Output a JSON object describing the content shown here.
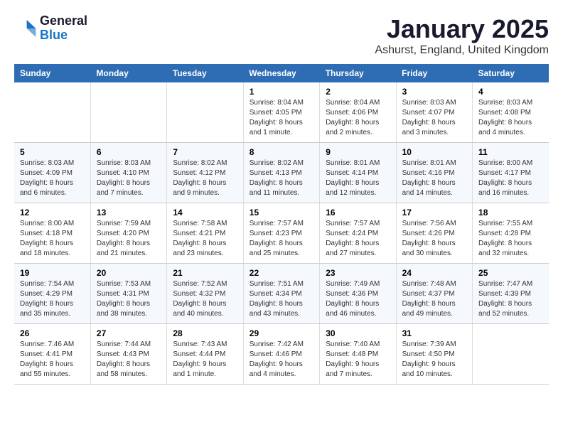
{
  "logo": {
    "line1": "General",
    "line2": "Blue"
  },
  "title": "January 2025",
  "subtitle": "Ashurst, England, United Kingdom",
  "weekdays": [
    "Sunday",
    "Monday",
    "Tuesday",
    "Wednesday",
    "Thursday",
    "Friday",
    "Saturday"
  ],
  "weeks": [
    [
      {
        "day": "",
        "info": ""
      },
      {
        "day": "",
        "info": ""
      },
      {
        "day": "",
        "info": ""
      },
      {
        "day": "1",
        "info": "Sunrise: 8:04 AM\nSunset: 4:05 PM\nDaylight: 8 hours and 1 minute."
      },
      {
        "day": "2",
        "info": "Sunrise: 8:04 AM\nSunset: 4:06 PM\nDaylight: 8 hours and 2 minutes."
      },
      {
        "day": "3",
        "info": "Sunrise: 8:03 AM\nSunset: 4:07 PM\nDaylight: 8 hours and 3 minutes."
      },
      {
        "day": "4",
        "info": "Sunrise: 8:03 AM\nSunset: 4:08 PM\nDaylight: 8 hours and 4 minutes."
      }
    ],
    [
      {
        "day": "5",
        "info": "Sunrise: 8:03 AM\nSunset: 4:09 PM\nDaylight: 8 hours and 6 minutes."
      },
      {
        "day": "6",
        "info": "Sunrise: 8:03 AM\nSunset: 4:10 PM\nDaylight: 8 hours and 7 minutes."
      },
      {
        "day": "7",
        "info": "Sunrise: 8:02 AM\nSunset: 4:12 PM\nDaylight: 8 hours and 9 minutes."
      },
      {
        "day": "8",
        "info": "Sunrise: 8:02 AM\nSunset: 4:13 PM\nDaylight: 8 hours and 11 minutes."
      },
      {
        "day": "9",
        "info": "Sunrise: 8:01 AM\nSunset: 4:14 PM\nDaylight: 8 hours and 12 minutes."
      },
      {
        "day": "10",
        "info": "Sunrise: 8:01 AM\nSunset: 4:16 PM\nDaylight: 8 hours and 14 minutes."
      },
      {
        "day": "11",
        "info": "Sunrise: 8:00 AM\nSunset: 4:17 PM\nDaylight: 8 hours and 16 minutes."
      }
    ],
    [
      {
        "day": "12",
        "info": "Sunrise: 8:00 AM\nSunset: 4:18 PM\nDaylight: 8 hours and 18 minutes."
      },
      {
        "day": "13",
        "info": "Sunrise: 7:59 AM\nSunset: 4:20 PM\nDaylight: 8 hours and 21 minutes."
      },
      {
        "day": "14",
        "info": "Sunrise: 7:58 AM\nSunset: 4:21 PM\nDaylight: 8 hours and 23 minutes."
      },
      {
        "day": "15",
        "info": "Sunrise: 7:57 AM\nSunset: 4:23 PM\nDaylight: 8 hours and 25 minutes."
      },
      {
        "day": "16",
        "info": "Sunrise: 7:57 AM\nSunset: 4:24 PM\nDaylight: 8 hours and 27 minutes."
      },
      {
        "day": "17",
        "info": "Sunrise: 7:56 AM\nSunset: 4:26 PM\nDaylight: 8 hours and 30 minutes."
      },
      {
        "day": "18",
        "info": "Sunrise: 7:55 AM\nSunset: 4:28 PM\nDaylight: 8 hours and 32 minutes."
      }
    ],
    [
      {
        "day": "19",
        "info": "Sunrise: 7:54 AM\nSunset: 4:29 PM\nDaylight: 8 hours and 35 minutes."
      },
      {
        "day": "20",
        "info": "Sunrise: 7:53 AM\nSunset: 4:31 PM\nDaylight: 8 hours and 38 minutes."
      },
      {
        "day": "21",
        "info": "Sunrise: 7:52 AM\nSunset: 4:32 PM\nDaylight: 8 hours and 40 minutes."
      },
      {
        "day": "22",
        "info": "Sunrise: 7:51 AM\nSunset: 4:34 PM\nDaylight: 8 hours and 43 minutes."
      },
      {
        "day": "23",
        "info": "Sunrise: 7:49 AM\nSunset: 4:36 PM\nDaylight: 8 hours and 46 minutes."
      },
      {
        "day": "24",
        "info": "Sunrise: 7:48 AM\nSunset: 4:37 PM\nDaylight: 8 hours and 49 minutes."
      },
      {
        "day": "25",
        "info": "Sunrise: 7:47 AM\nSunset: 4:39 PM\nDaylight: 8 hours and 52 minutes."
      }
    ],
    [
      {
        "day": "26",
        "info": "Sunrise: 7:46 AM\nSunset: 4:41 PM\nDaylight: 8 hours and 55 minutes."
      },
      {
        "day": "27",
        "info": "Sunrise: 7:44 AM\nSunset: 4:43 PM\nDaylight: 8 hours and 58 minutes."
      },
      {
        "day": "28",
        "info": "Sunrise: 7:43 AM\nSunset: 4:44 PM\nDaylight: 9 hours and 1 minute."
      },
      {
        "day": "29",
        "info": "Sunrise: 7:42 AM\nSunset: 4:46 PM\nDaylight: 9 hours and 4 minutes."
      },
      {
        "day": "30",
        "info": "Sunrise: 7:40 AM\nSunset: 4:48 PM\nDaylight: 9 hours and 7 minutes."
      },
      {
        "day": "31",
        "info": "Sunrise: 7:39 AM\nSunset: 4:50 PM\nDaylight: 9 hours and 10 minutes."
      },
      {
        "day": "",
        "info": ""
      }
    ]
  ]
}
